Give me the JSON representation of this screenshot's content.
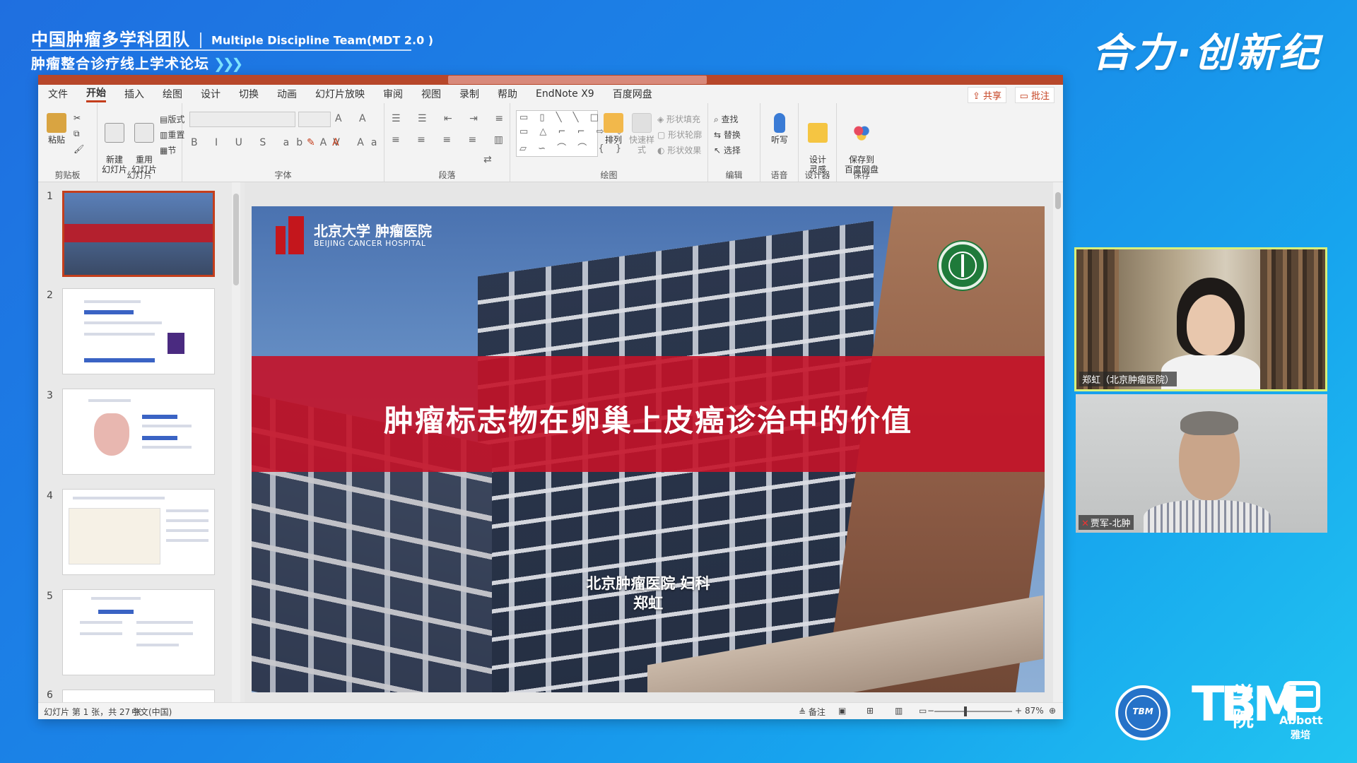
{
  "broadcast": {
    "title_cn": "中国肿瘤多学科团队",
    "title_en": "Multiple Discipline Team(MDT 2.0 )",
    "subtitle": "肿瘤整合诊疗线上学术论坛",
    "slogan": "合力·创新纪"
  },
  "ppt": {
    "menu": [
      "文件",
      "开始",
      "插入",
      "绘图",
      "设计",
      "切换",
      "动画",
      "幻灯片放映",
      "审阅",
      "视图",
      "录制",
      "帮助",
      "EndNote X9",
      "百度网盘"
    ],
    "active_menu": "开始",
    "share_label": "共享",
    "comment_label": "批注",
    "ribbon": {
      "paste": "粘贴",
      "new_slide": "新建\n幻灯片",
      "reuse_slide": "重用\n幻灯片",
      "layout": "版式",
      "reset": "重置",
      "section": "节",
      "arrange": "排列",
      "quick_styles": "快速样式",
      "shape_fill": "形状填充",
      "shape_outline": "形状轮廓",
      "shape_effects": "形状效果",
      "find": "查找",
      "replace": "替换",
      "select": "选择",
      "dictate": "听写",
      "designer": "设计\n灵感",
      "save_baidu": "保存到\n百度网盘",
      "groups": [
        "剪贴板",
        "幻灯片",
        "字体",
        "段落",
        "绘图",
        "编辑",
        "语音",
        "设计器",
        "保存"
      ]
    },
    "thumb_numbers": [
      "1",
      "2",
      "3",
      "4",
      "5",
      "6"
    ],
    "slide": {
      "logo_cn": "北京大学 肿瘤医院",
      "logo_en": "BEIJING CANCER HOSPITAL",
      "title": "肿瘤标志物在卵巢上皮癌诊治中的价值",
      "dept": "北京肿瘤医院 妇科",
      "presenter": "郑虹"
    },
    "status": {
      "slide_count": "幻灯片 第 1 张，共 27 张",
      "language": "中文(中国)",
      "notes": "备注",
      "zoom": "87%"
    }
  },
  "participants": [
    {
      "name": "郑虹（北京肿瘤医院）"
    },
    {
      "name": "贾军-北肿"
    }
  ],
  "logos": {
    "tbm": "TBM",
    "tbm_cn": "学\n院",
    "abbott": "Abbott",
    "abbott_cn": "雅培"
  },
  "colors": {
    "accent": "#c43e1c",
    "slide_band": "#c41228",
    "speaker_border": "#d9f07a"
  }
}
